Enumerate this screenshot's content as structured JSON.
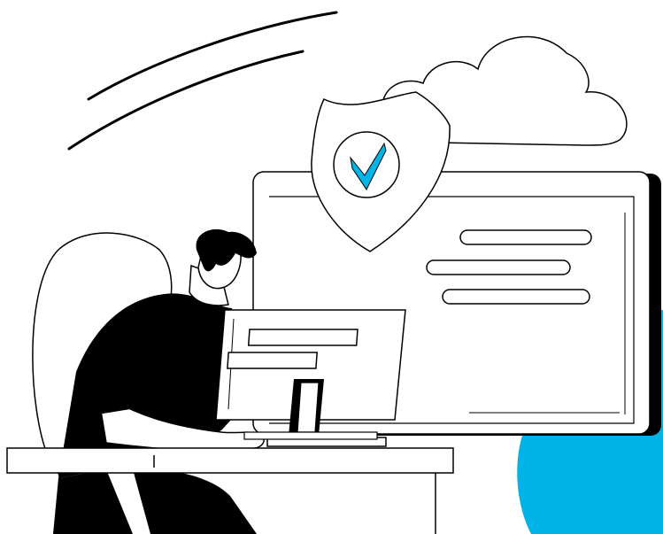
{
  "illustration": {
    "subject": "person-at-desk-with-security-cloud",
    "icons": [
      "cloud-icon",
      "shield-check-icon",
      "check-icon",
      "monitor-icon",
      "laptop-icon",
      "person-icon",
      "chair-icon",
      "desk-icon"
    ]
  },
  "colors": {
    "accent": "#00b4e8",
    "ink": "#000000",
    "paper": "#ffffff"
  }
}
